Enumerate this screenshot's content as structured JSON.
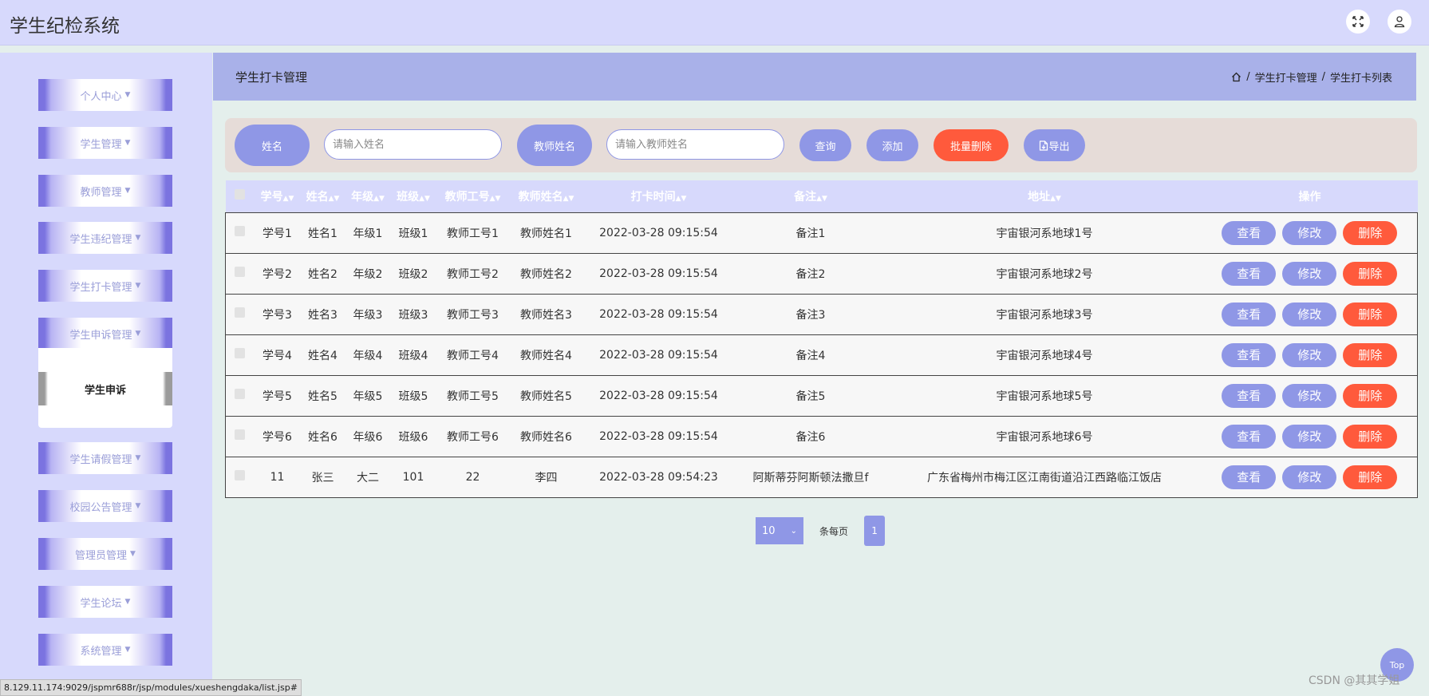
{
  "app": {
    "title": "学生纪检系统"
  },
  "topbar": {
    "fullscreen_icon": "fullscreen-icon",
    "user_icon": "user-icon"
  },
  "sidebar": {
    "items": [
      {
        "label": "个人中心"
      },
      {
        "label": "学生管理"
      },
      {
        "label": "教师管理"
      },
      {
        "label": "学生违纪管理"
      },
      {
        "label": "学生打卡管理"
      },
      {
        "label": "学生申诉管理"
      },
      {
        "label": "学生请假管理"
      },
      {
        "label": "校园公告管理"
      },
      {
        "label": "管理员管理"
      },
      {
        "label": "学生论坛"
      },
      {
        "label": "系统管理"
      }
    ],
    "submenu": {
      "label": "学生申诉"
    }
  },
  "header": {
    "title": "学生打卡管理",
    "breadcrumb": [
      "学生打卡管理",
      "学生打卡列表"
    ],
    "separator": "/"
  },
  "search": {
    "name_label": "姓名",
    "name_placeholder": "请输入姓名",
    "teacher_label": "教师姓名",
    "teacher_placeholder": "请输入教师姓名",
    "query_label": "查询",
    "add_label": "添加",
    "batch_delete_label": "批量删除",
    "export_label": "导出"
  },
  "table": {
    "columns": [
      "学号",
      "姓名",
      "年级",
      "班级",
      "教师工号",
      "教师姓名",
      "打卡时间",
      "备注",
      "地址",
      "操作"
    ],
    "rows": [
      [
        "学号1",
        "姓名1",
        "年级1",
        "班级1",
        "教师工号1",
        "教师姓名1",
        "2022-03-28 09:15:54",
        "备注1",
        "宇宙银河系地球1号"
      ],
      [
        "学号2",
        "姓名2",
        "年级2",
        "班级2",
        "教师工号2",
        "教师姓名2",
        "2022-03-28 09:15:54",
        "备注2",
        "宇宙银河系地球2号"
      ],
      [
        "学号3",
        "姓名3",
        "年级3",
        "班级3",
        "教师工号3",
        "教师姓名3",
        "2022-03-28 09:15:54",
        "备注3",
        "宇宙银河系地球3号"
      ],
      [
        "学号4",
        "姓名4",
        "年级4",
        "班级4",
        "教师工号4",
        "教师姓名4",
        "2022-03-28 09:15:54",
        "备注4",
        "宇宙银河系地球4号"
      ],
      [
        "学号5",
        "姓名5",
        "年级5",
        "班级5",
        "教师工号5",
        "教师姓名5",
        "2022-03-28 09:15:54",
        "备注5",
        "宇宙银河系地球5号"
      ],
      [
        "学号6",
        "姓名6",
        "年级6",
        "班级6",
        "教师工号6",
        "教师姓名6",
        "2022-03-28 09:15:54",
        "备注6",
        "宇宙银河系地球6号"
      ],
      [
        "11",
        "张三",
        "大二",
        "101",
        "22",
        "李四",
        "2022-03-28 09:54:23",
        "阿斯蒂芬阿斯顿法撒旦f",
        "广东省梅州市梅江区江南街道沿江西路临江饭店"
      ]
    ],
    "actions": {
      "view": "查看",
      "edit": "修改",
      "delete": "删除"
    }
  },
  "pager": {
    "page_size": "10",
    "per_page_label": "条每页",
    "current_page": "1"
  },
  "floating": {
    "top_label": "Top"
  },
  "status_url": "8.129.11.174:9029/jspmr688r/jsp/modules/xueshengdaka/list.jsp#",
  "watermark": "CSDN @其其学姐",
  "colors": {
    "accent": "#8f97e6",
    "danger": "#ff5a3c",
    "sidebar_bg": "#d7d9fc",
    "header_bg": "#a9b1e9",
    "search_bg": "#e6dcd8",
    "content_bg": "#e4efec"
  }
}
